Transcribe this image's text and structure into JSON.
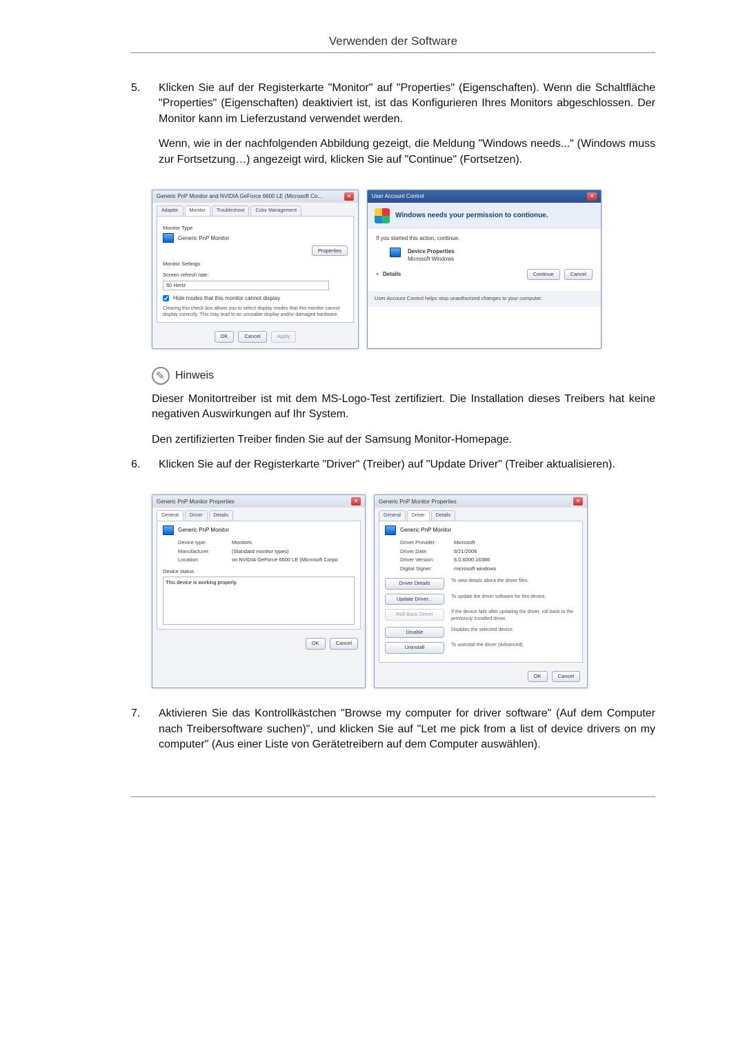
{
  "header": {
    "title": "Verwenden der Software"
  },
  "step5": {
    "num": "5.",
    "p1": "Klicken Sie auf der Registerkarte \"Monitor\" auf \"Properties\" (Eigenschaften). Wenn die Schaltfläche \"Properties\" (Eigenschaften) deaktiviert ist, ist das Konfigurieren Ihres Monitors abgeschlossen. Der Monitor kann im Lieferzustand verwendet werden.",
    "p2": "Wenn, wie in der nachfolgenden Abbildung gezeigt, die Meldung \"Windows needs...\" (Windows muss zur Fortsetzung…) angezeigt wird, klicken Sie auf \"Continue\" (Fortsetzen)."
  },
  "monitorDialog": {
    "title": "Generic PnP Monitor and NVIDIA GeForce 6600 LE (Microsoft Co...",
    "tabs": {
      "adapter": "Adapter",
      "monitor": "Monitor",
      "troubleshoot": "Troubleshoot",
      "color": "Color Management"
    },
    "section1": "Monitor Type",
    "monitorName": "Generic PnP Monitor",
    "propertiesBtn": "Properties",
    "section2": "Monitor Settings",
    "refreshLabel": "Screen refresh rate:",
    "refreshValue": "60 Hertz",
    "hideModes": "Hide modes that this monitor cannot display",
    "hideModesDesc": "Clearing this check box allows you to select display modes that this monitor cannot display correctly. This may lead to an unusable display and/or damaged hardware.",
    "ok": "OK",
    "cancel": "Cancel",
    "apply": "Apply"
  },
  "uac": {
    "title": "User Account Control",
    "headline": "Windows needs your permission to contionue.",
    "ifYou": "If you started this action, continue.",
    "itemTitle": "Device Properties",
    "itemVendor": "Microsoft Windows",
    "details": "Details",
    "continue": "Continue",
    "cancel": "Cancel",
    "footer": "User Account Control helps stop unauthorized changes to your computer."
  },
  "hinweis": {
    "label": "Hinweis",
    "p1": "Dieser Monitortreiber ist mit dem MS-Logo-Test zertifiziert. Die Installation dieses Treibers hat keine negativen Auswirkungen auf Ihr System.",
    "p2": "Den zertifizierten Treiber finden Sie auf der Samsung Monitor-Homepage."
  },
  "step6": {
    "num": "6.",
    "p1": "Klicken Sie auf der Registerkarte \"Driver\" (Treiber) auf \"Update Driver\" (Treiber aktualisieren)."
  },
  "generalDialog": {
    "title": "Generic PnP Monitor Properties",
    "tabs": {
      "general": "General",
      "driver": "Driver",
      "details": "Details"
    },
    "monitorName": "Generic PnP Monitor",
    "rows": {
      "deviceTypeK": "Device type:",
      "deviceTypeV": "Monitors",
      "manufacturerK": "Manufacturer:",
      "manufacturerV": "(Standard monitor types)",
      "locationK": "Location:",
      "locationV": "on NVIDIA GeForce 6600 LE (Microsoft Corpo"
    },
    "statusLabel": "Device status",
    "statusText": "This device is working properly.",
    "ok": "OK",
    "cancel": "Cancel"
  },
  "driverDialog": {
    "title": "Generic PnP Monitor Properties",
    "tabs": {
      "general": "General",
      "driver": "Driver",
      "details": "Details"
    },
    "monitorName": "Generic PnP Monitor",
    "rows": {
      "providerK": "Driver Provider:",
      "providerV": "Microsoft",
      "dateK": "Driver Date:",
      "dateV": "6/21/2006",
      "versionK": "Driver Version:",
      "versionV": "6.0.6000.16386",
      "signerK": "Digital Signer:",
      "signerV": "microsoft windows"
    },
    "buttons": {
      "detailsLabel": "Driver Details",
      "detailsDesc": "To view details about the driver files.",
      "updateLabel": "Update Driver...",
      "updateDesc": "To update the driver software for this device.",
      "rollLabel": "Roll Back Driver",
      "rollDesc": "If the device fails after updating the driver, roll back to the previously installed driver.",
      "disableLabel": "Disable",
      "disableDesc": "Disables the selected device.",
      "uninstallLabel": "Uninstall",
      "uninstallDesc": "To uninstall the driver (Advanced)."
    },
    "ok": "OK",
    "cancel": "Cancel"
  },
  "step7": {
    "num": "7.",
    "p1": "Aktivieren Sie das Kontrollkästchen \"Browse my computer for driver software\" (Auf dem Computer nach Treibersoftware suchen)\", und klicken Sie auf \"Let me pick from a list of device drivers on my computer\" (Aus einer Liste von Gerätetreibern auf dem Computer auswählen)."
  }
}
